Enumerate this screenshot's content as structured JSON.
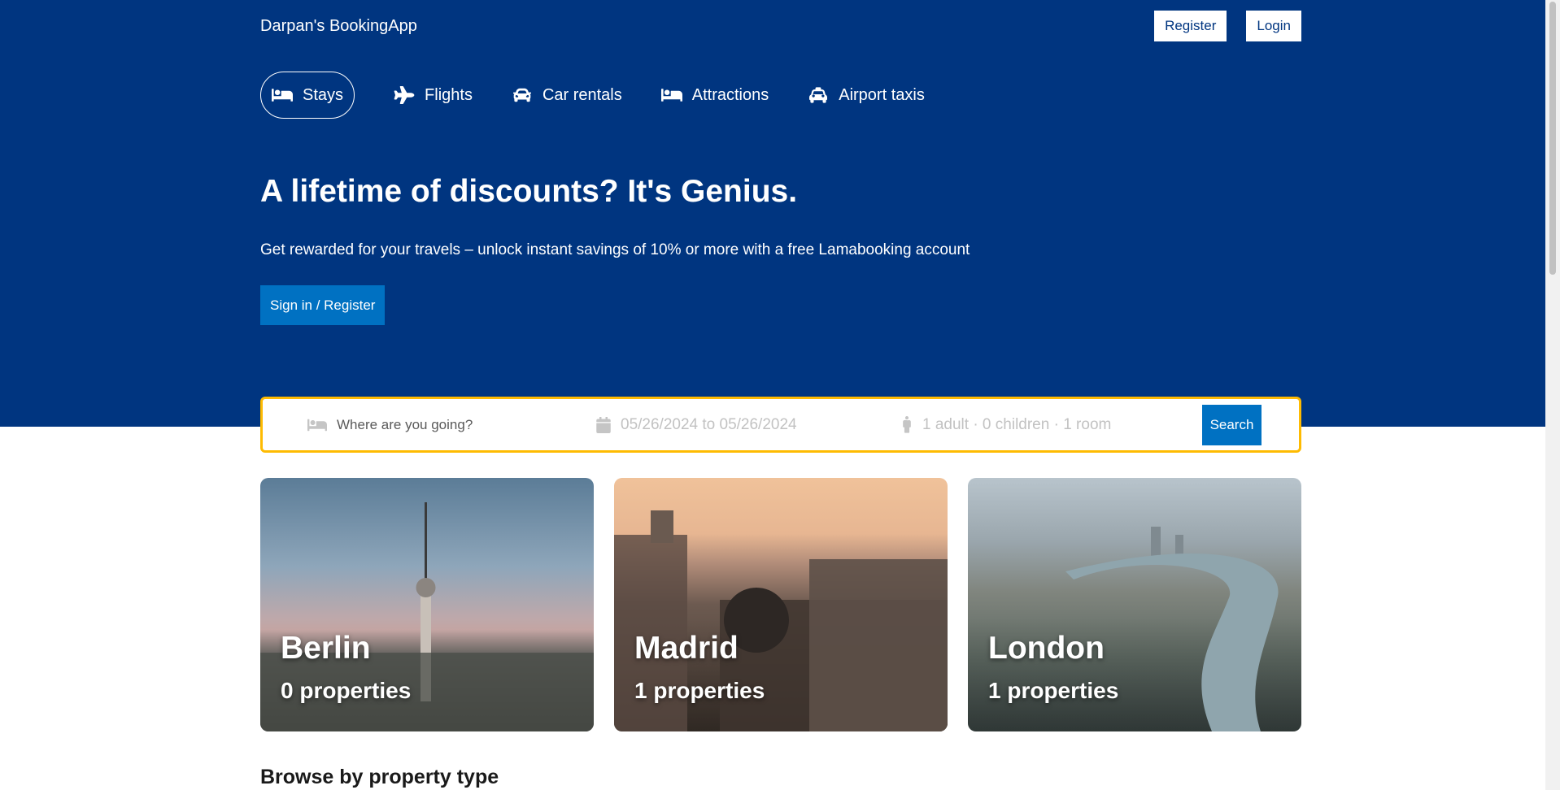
{
  "navbar": {
    "logo": "Darpan's BookingApp",
    "register_label": "Register",
    "login_label": "Login"
  },
  "tabs": [
    {
      "label": "Stays",
      "icon": "bed-icon",
      "active": true
    },
    {
      "label": "Flights",
      "icon": "plane-icon"
    },
    {
      "label": "Car rentals",
      "icon": "car-icon"
    },
    {
      "label": "Attractions",
      "icon": "bed-icon"
    },
    {
      "label": "Airport taxis",
      "icon": "taxi-icon"
    }
  ],
  "hero": {
    "title": "A lifetime of discounts? It's Genius.",
    "description": "Get rewarded for your travels – unlock instant savings of 10% or more with a free Lamabooking account",
    "button_label": "Sign in / Register"
  },
  "search": {
    "destination_placeholder": "Where are you going?",
    "dates": "05/26/2024 to 05/26/2024",
    "options": "1 adult · 0 children · 1 room",
    "button_label": "Search"
  },
  "featured": [
    {
      "city": "Berlin",
      "properties": "0 properties"
    },
    {
      "city": "Madrid",
      "properties": "1 properties"
    },
    {
      "city": "London",
      "properties": "1 properties"
    }
  ],
  "section": {
    "title": "Browse by property type"
  },
  "colors": {
    "header_bg": "#003580",
    "accent_blue": "#0071c2",
    "search_border": "#febb02"
  }
}
